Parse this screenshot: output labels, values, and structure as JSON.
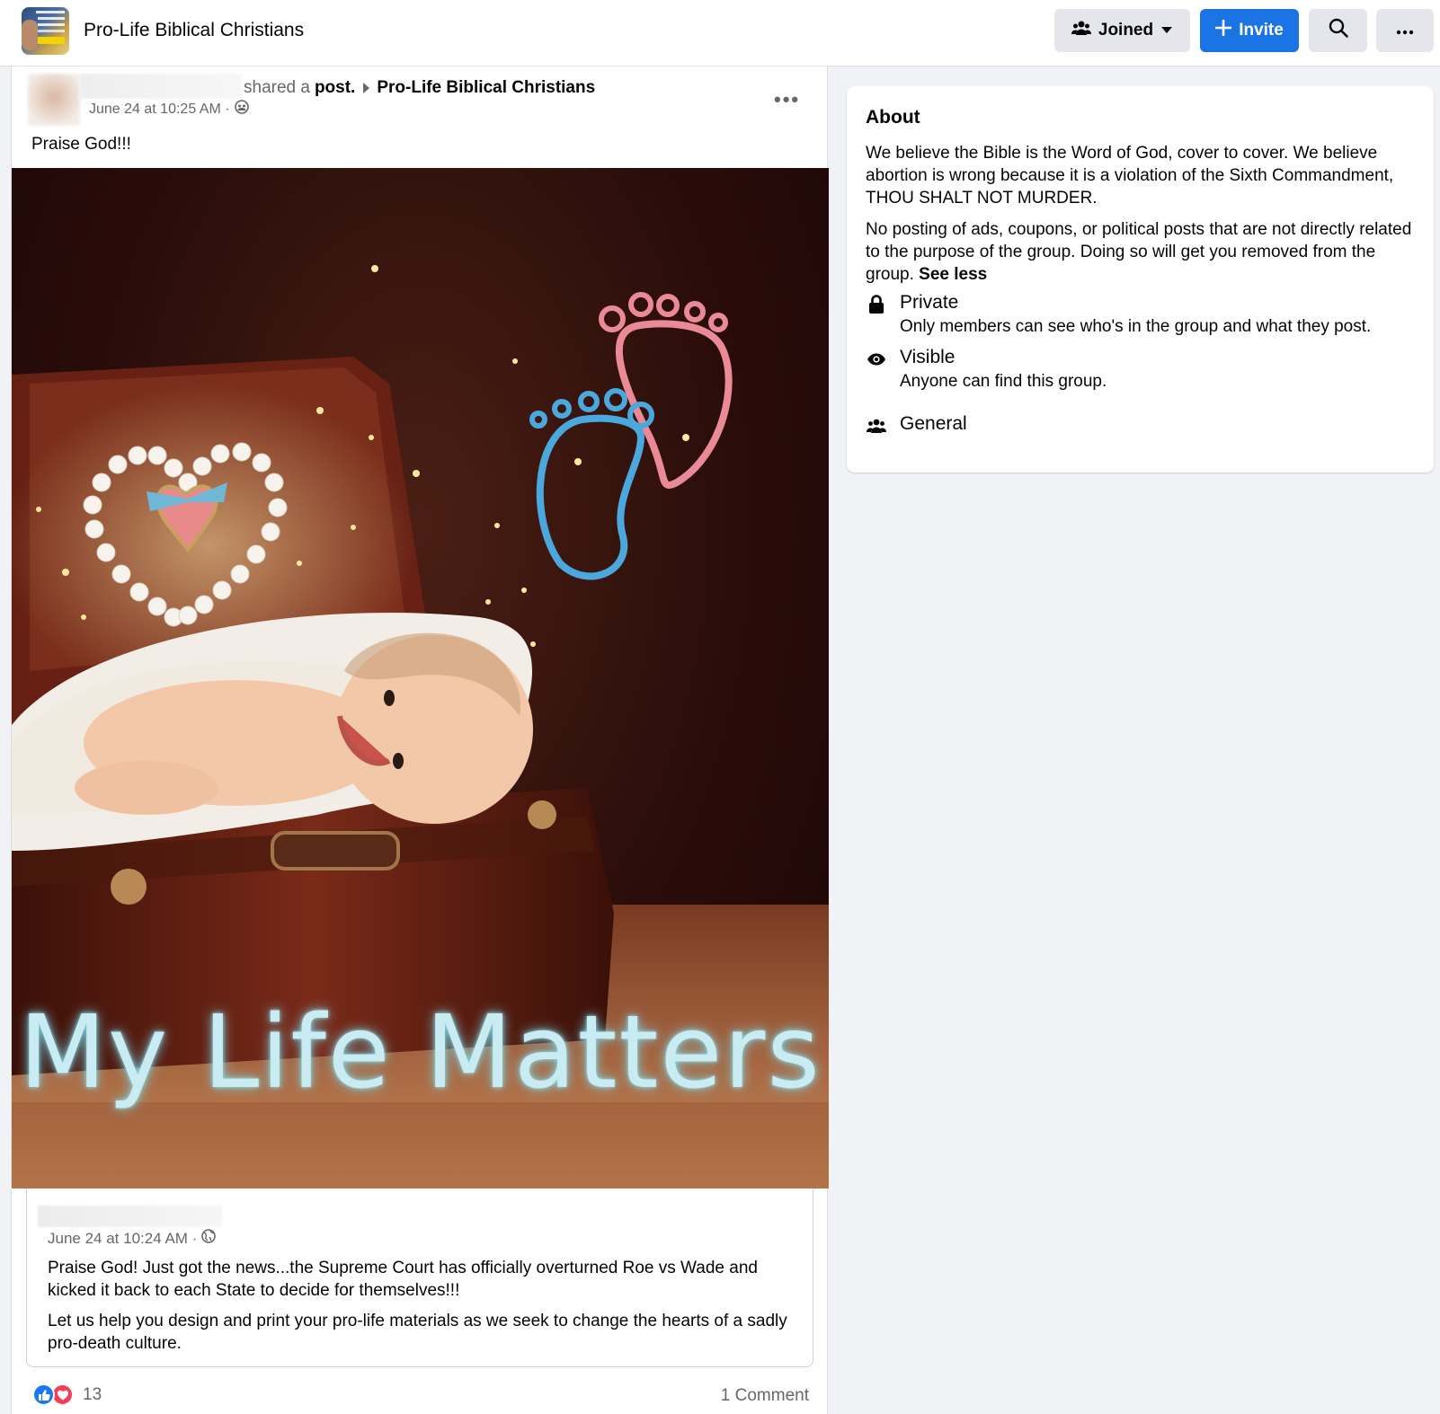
{
  "header": {
    "group_name": "Pro-Life Biblical Christians",
    "joined_label": "Joined",
    "invite_label": "Invite"
  },
  "post": {
    "shared_text": "shared a",
    "post_word": "post.",
    "group_link": "Pro-Life Biblical Christians",
    "timestamp": "June 24 at 10:25 AM ·",
    "text": "Praise God!!!",
    "image_caption": "My Life Matters"
  },
  "original": {
    "timestamp": "June 24 at 10:24 AM ·",
    "paragraph1": "Praise God! Just got the news...the Supreme Court has officially overturned Roe vs Wade and kicked it back to each State to decide for themselves!!!",
    "paragraph2": "Let us help you design and print your pro-life materials as we seek to change the hearts of a sadly pro-death culture."
  },
  "footer": {
    "reaction_count": "13",
    "comments_label": "1 Comment"
  },
  "about": {
    "title": "About",
    "paragraph1": "We believe the Bible is the Word of God, cover to cover. We believe abortion is wrong because it is a violation of the Sixth Commandment, THOU SHALT NOT MURDER.",
    "paragraph2": "No posting of ads, coupons, or political posts that are not directly related to the purpose of the group. Doing so will get you removed from the group.",
    "see_less": "See less",
    "private_title": "Private",
    "private_desc": "Only members can see who's in the group and what they post.",
    "visible_title": "Visible",
    "visible_desc": "Anyone can find this group.",
    "general_title": "General"
  },
  "colors": {
    "primary": "#1b74e4",
    "secondary_button": "#e4e6eb",
    "muted_text": "#65676b",
    "page_bg": "#f0f2f5",
    "like": "#1877f2",
    "love": "#f33e58"
  },
  "icons": [
    "group-joined-icon",
    "caret-down-icon",
    "plus-icon",
    "search-icon",
    "more-icon",
    "globe-icon",
    "lock-icon",
    "eye-icon",
    "people-icon",
    "like-icon",
    "love-icon"
  ]
}
